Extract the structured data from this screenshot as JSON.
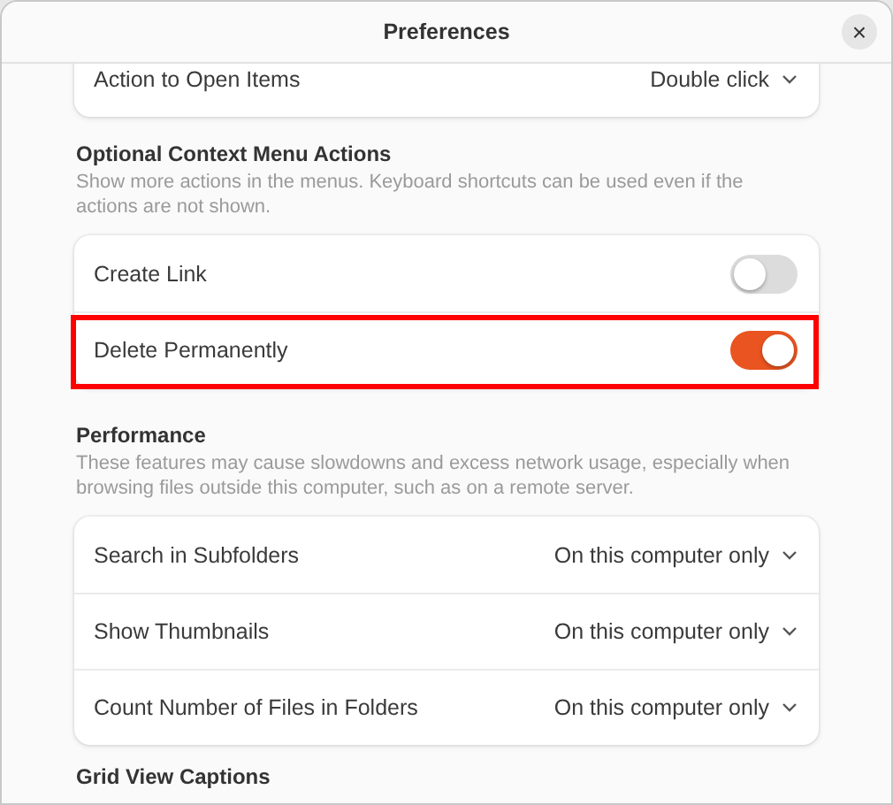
{
  "window": {
    "title": "Preferences",
    "close": "×"
  },
  "sections": [
    {
      "rows": [
        {
          "kind": "dropdown",
          "label": "Action to Open Items",
          "value": "Double click"
        }
      ]
    },
    {
      "title": "Optional Context Menu Actions",
      "description": "Show more actions in the menus. Keyboard shortcuts can be used even if the actions are not shown.",
      "rows": [
        {
          "kind": "switch",
          "label": "Create Link",
          "on": false,
          "highlighted": false
        },
        {
          "kind": "switch",
          "label": "Delete Permanently",
          "on": true,
          "highlighted": true
        }
      ]
    },
    {
      "title": "Performance",
      "description": "These features may cause slowdowns and excess network usage, especially when browsing files outside this computer, such as on a remote server.",
      "rows": [
        {
          "kind": "dropdown",
          "label": "Search in Subfolders",
          "value": "On this computer only"
        },
        {
          "kind": "dropdown",
          "label": "Show Thumbnails",
          "value": "On this computer only"
        },
        {
          "kind": "dropdown",
          "label": "Count Number of Files in Folders",
          "value": "On this computer only"
        }
      ]
    },
    {
      "title": "Grid View Captions"
    }
  ]
}
